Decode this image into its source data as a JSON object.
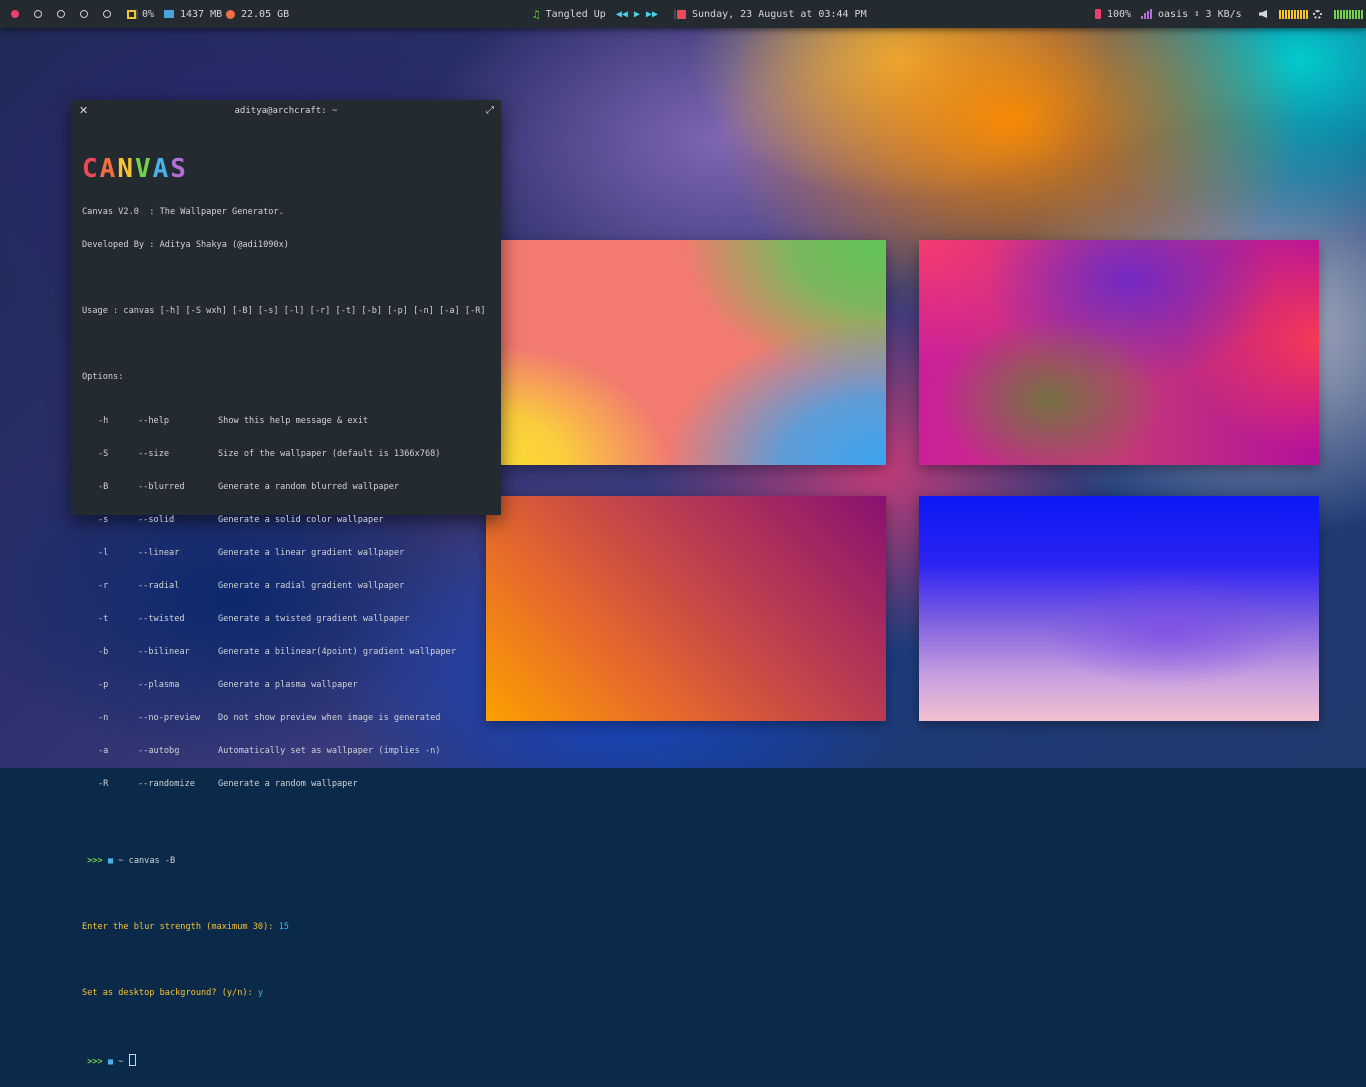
{
  "topbar": {
    "workspaces": [
      {
        "active": true
      },
      {
        "active": false
      },
      {
        "active": false
      },
      {
        "active": false
      },
      {
        "active": false
      }
    ],
    "cpu": "0%",
    "memory": "1437 MB",
    "disk": "22.05 GB",
    "song": "Tangled Up",
    "datetime": "Sunday, 23 August at 03:44 PM",
    "battery": "100%",
    "network_name": "oasis",
    "network_speed": "3 KB/s",
    "colors": {
      "bar_bg": "#232a30",
      "active_ws": "#ec3e69",
      "cpu": "#f7c331",
      "memory": "#4aa3df",
      "disk": "#f36f43",
      "music": "#74d14a",
      "controls": "#4ad2e8",
      "calendar": "#ec4a5a",
      "battery": "#ec3e69",
      "network": "#b46ed8"
    }
  },
  "terminal": {
    "title": "aditya@archcraft: ~",
    "logo": [
      "C",
      "A",
      "N",
      "V",
      "A",
      "S"
    ],
    "logo_colors": [
      "#ec4a5a",
      "#f36f43",
      "#f7c331",
      "#74d14a",
      "#4ab1e8",
      "#b46ed8"
    ],
    "version_line": "Canvas V2.0  : The Wallpaper Generator.",
    "author_line": "Developed By : Aditya Shakya (@adi1090x)",
    "usage_line": "Usage : canvas [-h] [-S wxh] [-B] [-s] [-l] [-r] [-t] [-b] [-p] [-n] [-a] [-R]",
    "options_header": "Options:",
    "options": [
      {
        "short": "-h",
        "long": "--help",
        "desc": "Show this help message & exit"
      },
      {
        "short": "-S",
        "long": "--size",
        "desc": "Size of the wallpaper (default is 1366x768)"
      },
      {
        "short": "-B",
        "long": "--blurred",
        "desc": "Generate a random blurred wallpaper"
      },
      {
        "short": "-s",
        "long": "--solid",
        "desc": "Generate a solid color wallpaper"
      },
      {
        "short": "-l",
        "long": "--linear",
        "desc": "Generate a linear gradient wallpaper"
      },
      {
        "short": "-r",
        "long": "--radial",
        "desc": "Generate a radial gradient wallpaper"
      },
      {
        "short": "-t",
        "long": "--twisted",
        "desc": "Generate a twisted gradient wallpaper"
      },
      {
        "short": "-b",
        "long": "--bilinear",
        "desc": "Generate a bilinear(4point) gradient wallpaper"
      },
      {
        "short": "-p",
        "long": "--plasma",
        "desc": "Generate a plasma wallpaper"
      },
      {
        "short": "-n",
        "long": "--no-preview",
        "desc": "Do not show preview when image is generated"
      },
      {
        "short": "-a",
        "long": "--autobg",
        "desc": "Automatically set as wallpaper (implies -n)"
      },
      {
        "short": "-R",
        "long": "--randomize",
        "desc": "Generate a random wallpaper"
      }
    ],
    "prompt_arrows": ">>>",
    "prompt_dir": "~",
    "command": "canvas -B",
    "blur_question": "Enter the blur strength (maximum 30): ",
    "blur_answer": "15",
    "bg_question": "Set as desktop background? (y/n): ",
    "bg_answer": "y"
  }
}
